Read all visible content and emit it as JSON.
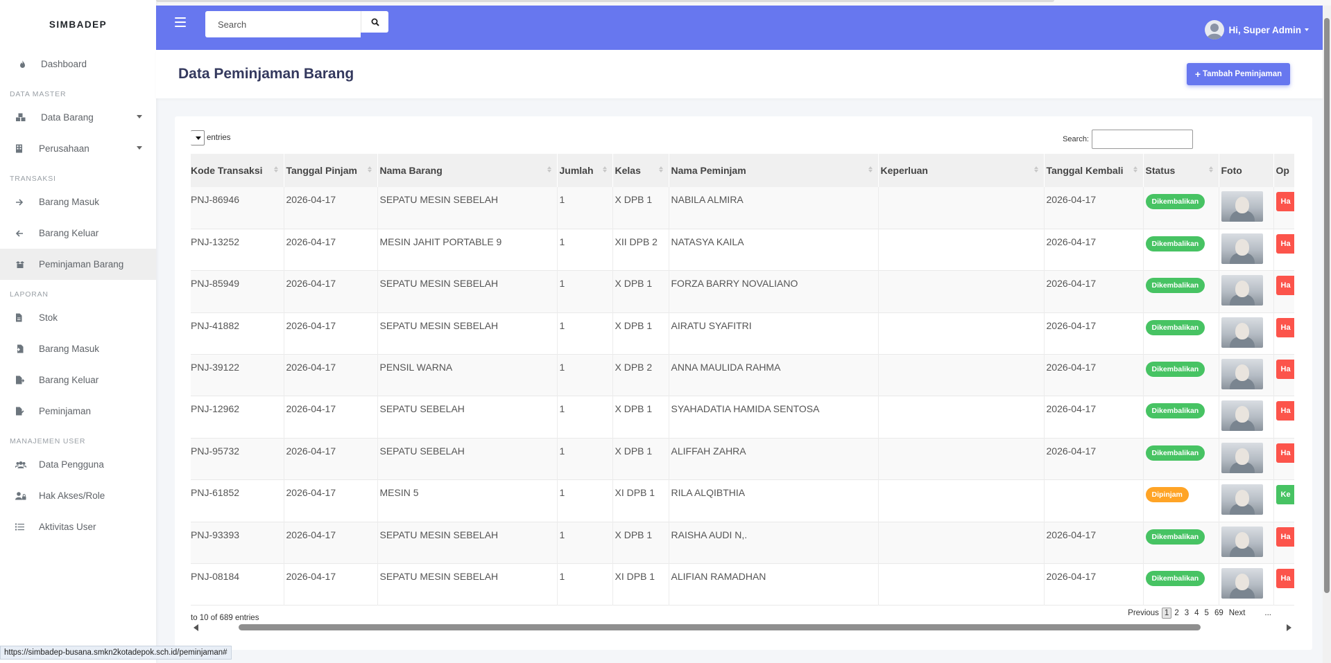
{
  "brand": "SIMBADEP",
  "sidebar": {
    "dashboard": "Dashboard",
    "header_master": "DATA MASTER",
    "data_barang": "Data Barang",
    "perusahaan": "Perusahaan",
    "header_transaksi": "TRANSAKSI",
    "barang_masuk": "Barang Masuk",
    "barang_keluar": "Barang Keluar",
    "peminjaman_barang": "Peminjaman Barang",
    "header_laporan": "LAPORAN",
    "stok": "Stok",
    "lap_barang_masuk": "Barang Masuk",
    "lap_barang_keluar": "Barang Keluar",
    "lap_peminjaman": "Peminjaman",
    "header_user": "MANAJEMEN USER",
    "data_pengguna": "Data Pengguna",
    "hak_akses": "Hak Akses/Role",
    "aktivitas_user": "Aktivitas User"
  },
  "topbar": {
    "search_placeholder": "Search",
    "user_greeting": "Hi, Super Admin"
  },
  "page": {
    "title": "Data Peminjaman Barang",
    "add_button": "Tambah Peminjaman"
  },
  "table": {
    "entries_label": "entries",
    "search_label": "Search:",
    "columns": [
      "Kode Transaksi",
      "Tanggal Pinjam",
      "Nama Barang",
      "Jumlah",
      "Kelas",
      "Nama Peminjam",
      "Keperluan",
      "Tanggal Kembali",
      "Status",
      "Foto",
      "Op"
    ],
    "rows": [
      {
        "kode": "PNJ-86946",
        "tgl": "2026-04-17",
        "barang": "SEPATU MESIN SEBELAH",
        "jumlah": "1",
        "kelas": "X DPB 1",
        "peminjam": "NABILA ALMIRA",
        "keperluan": "",
        "kembali": "2026-04-17",
        "status": "Dikembalikan",
        "op": "Ha"
      },
      {
        "kode": "PNJ-13252",
        "tgl": "2026-04-17",
        "barang": "MESIN JAHIT PORTABLE 9",
        "jumlah": "1",
        "kelas": "XII DPB 2",
        "peminjam": "NATASYA KAILA",
        "keperluan": "",
        "kembali": "2026-04-17",
        "status": "Dikembalikan",
        "op": "Ha"
      },
      {
        "kode": "PNJ-85949",
        "tgl": "2026-04-17",
        "barang": "SEPATU MESIN SEBELAH",
        "jumlah": "1",
        "kelas": "X DPB 1",
        "peminjam": "FORZA BARRY NOVALIANO",
        "keperluan": "",
        "kembali": "2026-04-17",
        "status": "Dikembalikan",
        "op": "Ha"
      },
      {
        "kode": "PNJ-41882",
        "tgl": "2026-04-17",
        "barang": "SEPATU MESIN SEBELAH",
        "jumlah": "1",
        "kelas": "X DPB 1",
        "peminjam": "AIRATU SYAFITRI",
        "keperluan": "",
        "kembali": "2026-04-17",
        "status": "Dikembalikan",
        "op": "Ha"
      },
      {
        "kode": "PNJ-39122",
        "tgl": "2026-04-17",
        "barang": "PENSIL WARNA",
        "jumlah": "1",
        "kelas": "X DPB 2",
        "peminjam": "ANNA MAULIDA RAHMA",
        "keperluan": "",
        "kembali": "2026-04-17",
        "status": "Dikembalikan",
        "op": "Ha"
      },
      {
        "kode": "PNJ-12962",
        "tgl": "2026-04-17",
        "barang": "SEPATU SEBELAH",
        "jumlah": "1",
        "kelas": "X DPB 1",
        "peminjam": "SYAHADATIA HAMIDA SENTOSA",
        "keperluan": "",
        "kembali": "2026-04-17",
        "status": "Dikembalikan",
        "op": "Ha"
      },
      {
        "kode": "PNJ-95732",
        "tgl": "2026-04-17",
        "barang": "SEPATU SEBELAH",
        "jumlah": "1",
        "kelas": "X DPB 1",
        "peminjam": "ALIFFAH ZAHRA",
        "keperluan": "",
        "kembali": "2026-04-17",
        "status": "Dikembalikan",
        "op": "Ha"
      },
      {
        "kode": "PNJ-61852",
        "tgl": "2026-04-17",
        "barang": "MESIN 5",
        "jumlah": "1",
        "kelas": "XI DPB 1",
        "peminjam": "RILA ALQIBTHIA",
        "keperluan": "",
        "kembali": "",
        "status": "Dipinjam",
        "op": "Ke"
      },
      {
        "kode": "PNJ-93393",
        "tgl": "2026-04-17",
        "barang": "SEPATU MESIN SEBELAH",
        "jumlah": "1",
        "kelas": "X DPB 1",
        "peminjam": "RAISHA AUDI N,.",
        "keperluan": "",
        "kembali": "2026-04-17",
        "status": "Dikembalikan",
        "op": "Ha"
      },
      {
        "kode": "PNJ-08184",
        "tgl": "2026-04-17",
        "barang": "SEPATU MESIN SEBELAH",
        "jumlah": "1",
        "kelas": "XI DPB 1",
        "peminjam": "ALIFIAN RAMADHAN",
        "keperluan": "",
        "kembali": "2026-04-17",
        "status": "Dikembalikan",
        "op": "Ha"
      }
    ],
    "info": "to 10 of 689 entries",
    "pagination": {
      "previous": "Previous",
      "pages": [
        "1",
        "2",
        "3",
        "4",
        "5",
        "69"
      ],
      "next": "Next",
      "ellipsis": "..."
    }
  },
  "status_url": "https://simbadep-busana.smkn2kotadepok.sch.id/peminjaman#",
  "colors": {
    "primary": "#6777ef",
    "success": "#47c363",
    "warning": "#ffa426",
    "danger": "#fc544b"
  }
}
